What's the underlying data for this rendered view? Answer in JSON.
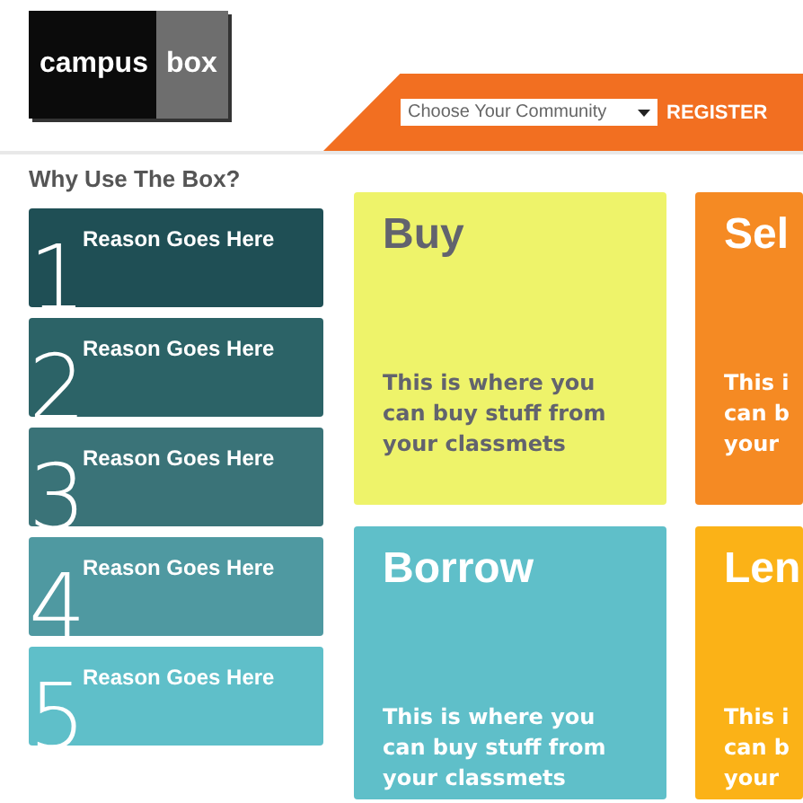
{
  "logo": {
    "first": "campus",
    "second": "box"
  },
  "community_select": {
    "value": "Choose Your Community"
  },
  "register": "REGISTER",
  "sidebar": {
    "heading": "Why Use The Box?",
    "reasons": [
      {
        "number": "1",
        "text": "Reason Goes Here",
        "color": "#1f4f55"
      },
      {
        "number": "2",
        "text": "Reason Goes Here",
        "color": "#2c6367"
      },
      {
        "number": "3",
        "text": "Reason Goes Here",
        "color": "#3a7378"
      },
      {
        "number": "4",
        "text": "Reason Goes Here",
        "color": "#4f99a1"
      },
      {
        "number": "5",
        "text": "Reason Goes Here",
        "color": "#5fbfc9"
      }
    ]
  },
  "tiles": [
    {
      "title": "Buy",
      "lines": [
        "This is where you",
        "can buy stuff from",
        "your classmets"
      ],
      "color": "#eef36a"
    },
    {
      "title": "Sel",
      "lines": [
        "This i",
        "can b",
        "your"
      ],
      "color": "#f58a23"
    },
    {
      "title": "Borrow",
      "lines": [
        "This is where you",
        "can buy stuff from",
        "your classmets"
      ],
      "color": "#5fbfc9"
    },
    {
      "title": "Len",
      "lines": [
        "This i",
        "can b",
        "your"
      ],
      "color": "#fbb217"
    }
  ]
}
